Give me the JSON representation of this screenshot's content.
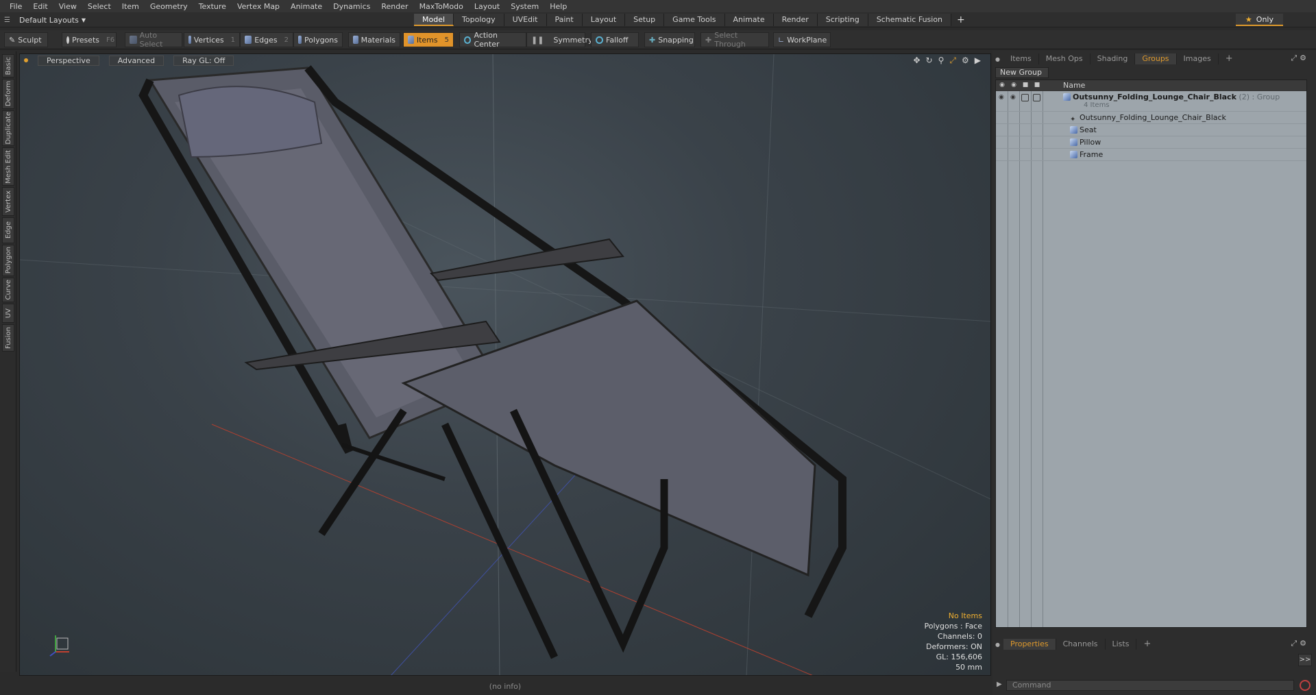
{
  "menubar": [
    "File",
    "Edit",
    "View",
    "Select",
    "Item",
    "Geometry",
    "Texture",
    "Vertex Map",
    "Animate",
    "Dynamics",
    "Render",
    "MaxToModo",
    "Layout",
    "System",
    "Help"
  ],
  "layout": {
    "selector": "Default Layouts",
    "only_label": "Only"
  },
  "mode_tabs": [
    "Model",
    "Topology",
    "UVEdit",
    "Paint",
    "Layout",
    "Setup",
    "Game Tools",
    "Animate",
    "Render",
    "Scripting",
    "Schematic Fusion"
  ],
  "active_mode_tab": "Model",
  "toolbar": {
    "sculpt": "Sculpt",
    "presets": "Presets",
    "presets_key": "F6",
    "auto_select": "Auto Select",
    "vertices": "Vertices",
    "vertices_key": "1",
    "edges": "Edges",
    "edges_key": "2",
    "polygons": "Polygons",
    "materials": "Materials",
    "items": "Items",
    "items_key": "5",
    "action_center": "Action Center",
    "symmetry": "Symmetry",
    "falloff": "Falloff",
    "snapping": "Snapping",
    "select_through": "Select Through",
    "workplane": "WorkPlane"
  },
  "left_tabs": [
    "Basic",
    "Deform",
    "Duplicate",
    "Mesh Edit",
    "Vertex",
    "Edge",
    "Polygon",
    "Curve",
    "UV",
    "Fusion"
  ],
  "viewport": {
    "view": "Perspective",
    "shading": "Advanced",
    "raygl": "Ray GL: Off",
    "hud": {
      "selection": "No Items",
      "polygons": "Polygons : Face",
      "channels": "Channels: 0",
      "deformers": "Deformers: ON",
      "gl": "GL: 156,606",
      "unit": "50 mm"
    }
  },
  "status": "(no info)",
  "right_panel": {
    "tabs": [
      "Items",
      "Mesh Ops",
      "Shading",
      "Groups",
      "Images"
    ],
    "active_tab": "Groups",
    "new_group": "New Group",
    "column_name": "Name",
    "group": {
      "name": "Outsunny_Folding_Lounge_Chair_Black",
      "count": "(2)",
      "type": ": Group",
      "items_label": "4 Items",
      "children": [
        "Outsunny_Folding_Lounge_Chair_Black",
        "Seat",
        "Pillow",
        "Frame"
      ]
    },
    "bottom_tabs": [
      "Properties",
      "Channels",
      "Lists"
    ],
    "active_bottom_tab": "Properties",
    "command_placeholder": "Command"
  },
  "colors": {
    "accent": "#e0932a",
    "list_bg": "#9da5ab"
  }
}
